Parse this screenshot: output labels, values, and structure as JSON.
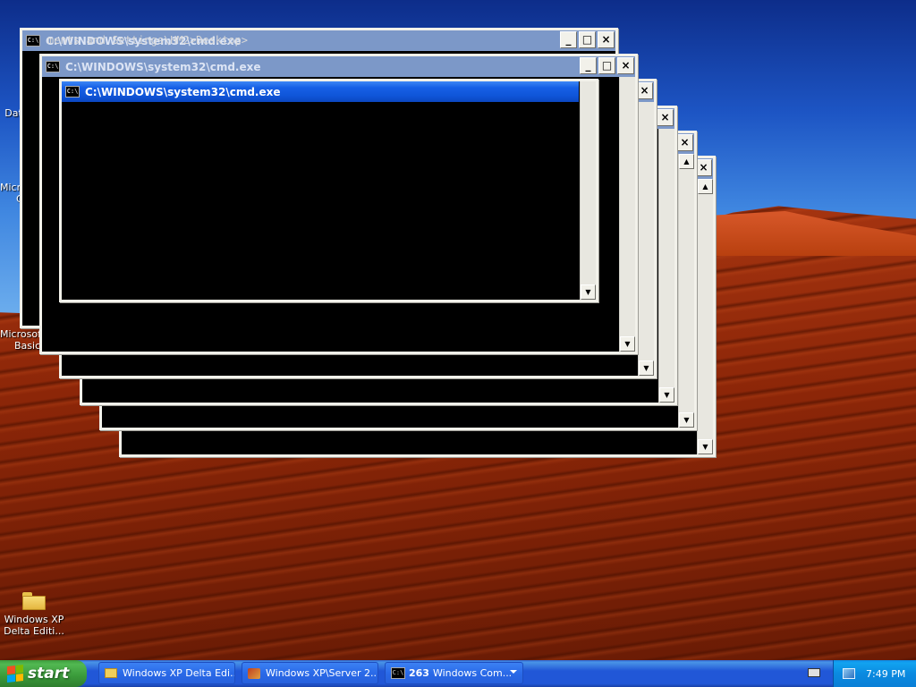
{
  "desktop": {
    "icons": [
      {
        "label_line1": "Dat",
        "label_line2": ""
      },
      {
        "label_line1": "Microsoft",
        "label_line2": "C"
      },
      {
        "label_line1": "Microsoft",
        "label_line2": "Basic"
      },
      {
        "label_line1": "Windows XP",
        "label_line2": "Delta Editi..."
      }
    ]
  },
  "windows": {
    "title": "C:\\WINDOWS\\system32\\cmd.exe",
    "back_console_text": "ments and Settings\\HM2>Desktop>",
    "min": "_",
    "max": "□",
    "close": "×",
    "scroll_down": "▼",
    "scroll_up": "▲",
    "cmd_icon": "C:\\"
  },
  "taskbar": {
    "start_label": "start",
    "tasks": [
      {
        "label": "Windows XP Delta Edi...",
        "icon": "folder-icon"
      },
      {
        "label": "Windows XP\\Server 2...",
        "icon": "setup-icon"
      },
      {
        "count": "263",
        "label": "Windows Com...",
        "icon": "cmd-icon"
      }
    ],
    "clock": "7:49 PM"
  }
}
